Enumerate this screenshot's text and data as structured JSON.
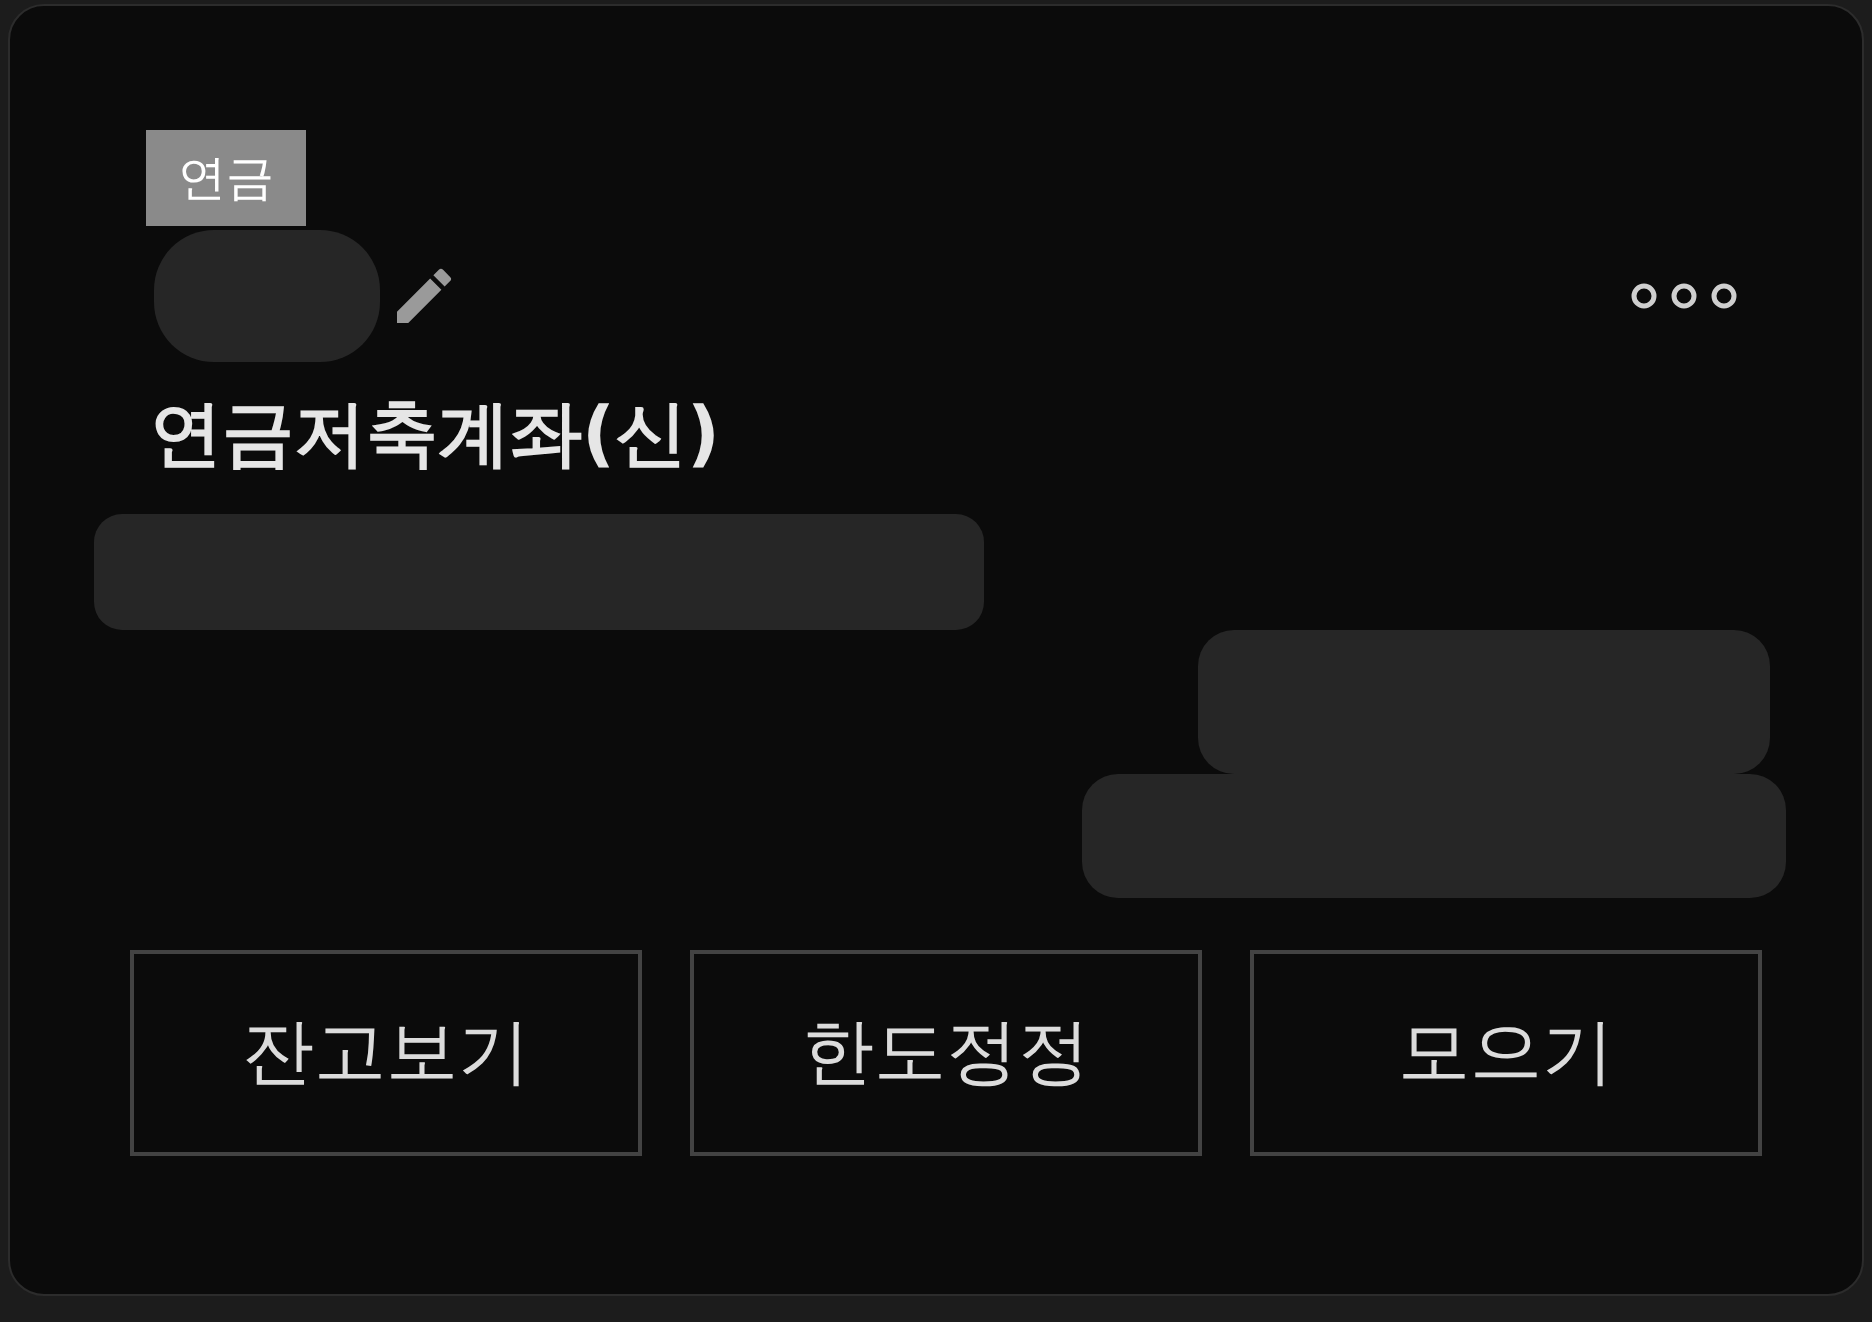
{
  "badge": "연금",
  "account_title": "연금저축계좌(신)",
  "buttons": [
    {
      "label": "잔고보기"
    },
    {
      "label": "한도정정"
    },
    {
      "label": "모으기"
    }
  ]
}
